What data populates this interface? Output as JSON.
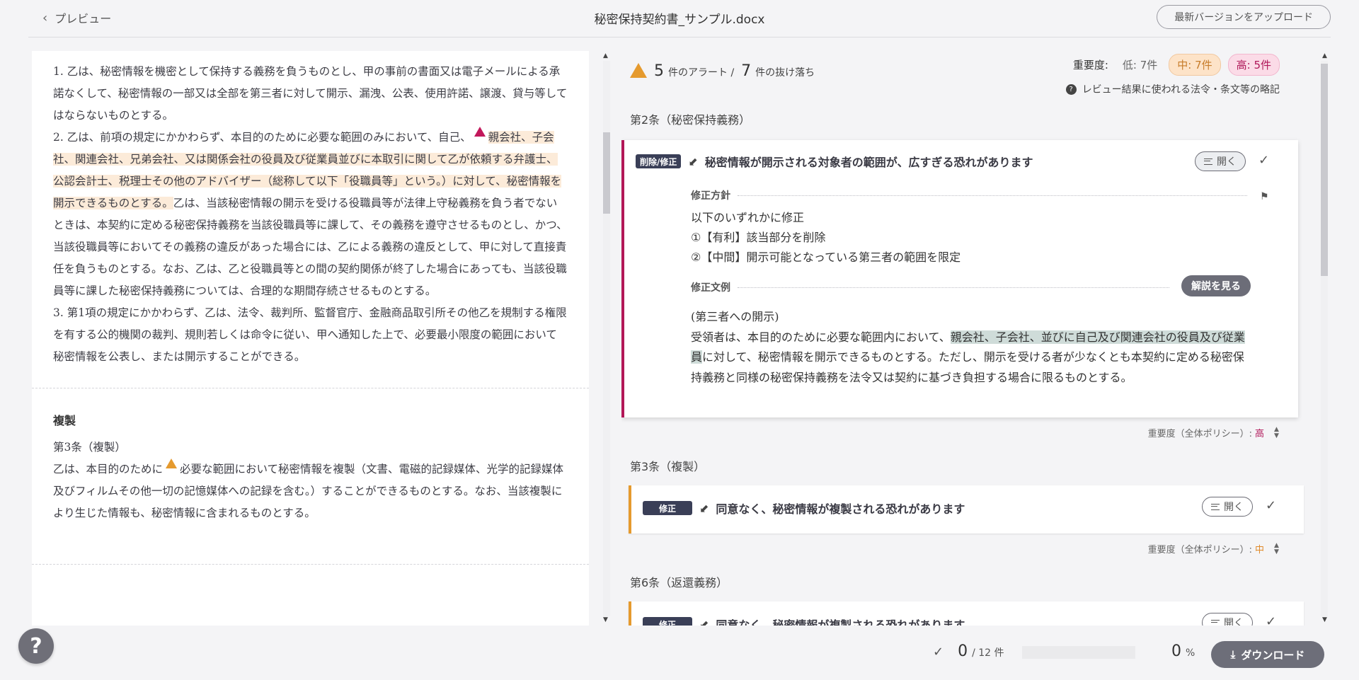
{
  "header": {
    "back_label": "プレビュー",
    "doc_title": "秘密保持契約書_サンプル.docx",
    "upload_label": "最新バージョンをアップロード"
  },
  "document": {
    "p1": "1. 乙は、秘密情報を機密として保持する義務を負うものとし、甲の事前の書面又は電子メールによる承諾なくして、秘密情報の一部又は全部を第三者に対して開示、漏洩、公表、使用許諾、譲渡、貸与等してはならないものとする。",
    "p2_pre": "2. 乙は、前項の規定にかかわらず、本目的のために必要な範囲のみにおいて、自己、",
    "p2_hl": "親会社、子会社、関連会社、兄弟会社、又は関係会社の役員及び従業員並びに本取引に関して乙が依頼する弁護士、公認会計士、税理士その他のアドバイザー（総称して以下「役職員等」という。）に対して、秘密情報を開示できるものとする。",
    "p2_post": "乙は、当該秘密情報の開示を受ける役職員等が法律上守秘義務を負う者でないときは、本契約に定める秘密保持義務を当該役職員等に課して、その義務を遵守させるものとし、かつ、当該役職員等においてその義務の違反があった場合には、乙による義務の違反として、甲に対して直接責任を負うものとする。なお、乙は、乙と役職員等との間の契約関係が終了した場合にあっても、当該役職員等に課した秘密保持義務については、合理的な期間存続させるものとする。",
    "p3": "3. 第1項の規定にかかわらず、乙は、法令、裁判所、監督官庁、金融商品取引所その他乙を規制する権限を有する公的機関の裁判、規則若しくは命令に従い、甲へ通知した上で、必要最小限度の範囲において秘密情報を公表し、または開示することができる。",
    "sec2_heading": "複製",
    "sec2_article": "第3条（複製）",
    "sec2_pre": "乙は、本目的のために",
    "sec2_post": "必要な範囲において秘密情報を複製（文書、電磁的記録媒体、光学的記録媒体及びフィルムその他一切の記憶媒体への記録を含む。）することができるものとする。なお、当該複製により生じた情報も、秘密情報に含まれるものとする。"
  },
  "summary": {
    "alerts_count": "5",
    "alerts_label": "件のアラート /",
    "omissions_count": "7",
    "omissions_label": "件の抜け落ち",
    "severity_label": "重要度:",
    "low": "低: 7件",
    "mid": "中: 7件",
    "high": "高: 5件",
    "legal_abbrev": "レビュー結果に使われる法令・条文等の略記"
  },
  "articles": [
    {
      "heading": "第2条（秘密保持義務）",
      "tag": "削除/修正",
      "title": "秘密情報が開示される対象者の範囲が、広すぎる恐れがあります",
      "open_label": "開く",
      "policy_label": "修正方針",
      "policy_lines": [
        "以下のいずれかに修正",
        "①【有利】該当部分を削除",
        "②【中間】開示可能となっている第三者の範囲を限定"
      ],
      "sample_label": "修正文例",
      "explain_label": "解説を見る",
      "sample_heading": "(第三者への開示)",
      "sample_pre": "受領者は、本目的のために必要な範囲内において、",
      "sample_hl": "親会社、子会社、並びに自己及び関連会社の役員及び従業員",
      "sample_post": "に対して、秘密情報を開示できるものとする。ただし、開示を受ける者が少なくとも本契約に定める秘密保持義務と同様の秘密保持義務を法令又は契約に基づき負担する場合に限るものとする。",
      "severity_policy": "重要度（全体ポリシー）:",
      "severity_value": "高"
    },
    {
      "heading": "第3条（複製）",
      "tag": "修正",
      "title": "同意なく、秘密情報が複製される恐れがあります",
      "open_label": "開く",
      "severity_policy": "重要度（全体ポリシー）:",
      "severity_value": "中"
    },
    {
      "heading": "第6条（返還義務）",
      "tag": "修正",
      "title": "同意なく、秘密情報が複製される恐れがあります",
      "open_label": "開く"
    }
  ],
  "footer": {
    "done": "0",
    "total": "/ 12 件",
    "percent": "0",
    "percent_unit": "%",
    "progress_fraction": 0,
    "download_label": "ダウンロード"
  },
  "colors": {
    "accent_high": "#b21757",
    "accent_mid": "#e59a2e",
    "highlight": "#fcebd9",
    "sample_highlight": "#cfdcd9"
  },
  "icons": [
    "chevron-left-icon",
    "warning-icon",
    "alert-icon",
    "question-icon",
    "lines-icon",
    "check-icon",
    "flag-icon",
    "edit-icon",
    "updown-icon",
    "download-icon",
    "help-icon"
  ]
}
